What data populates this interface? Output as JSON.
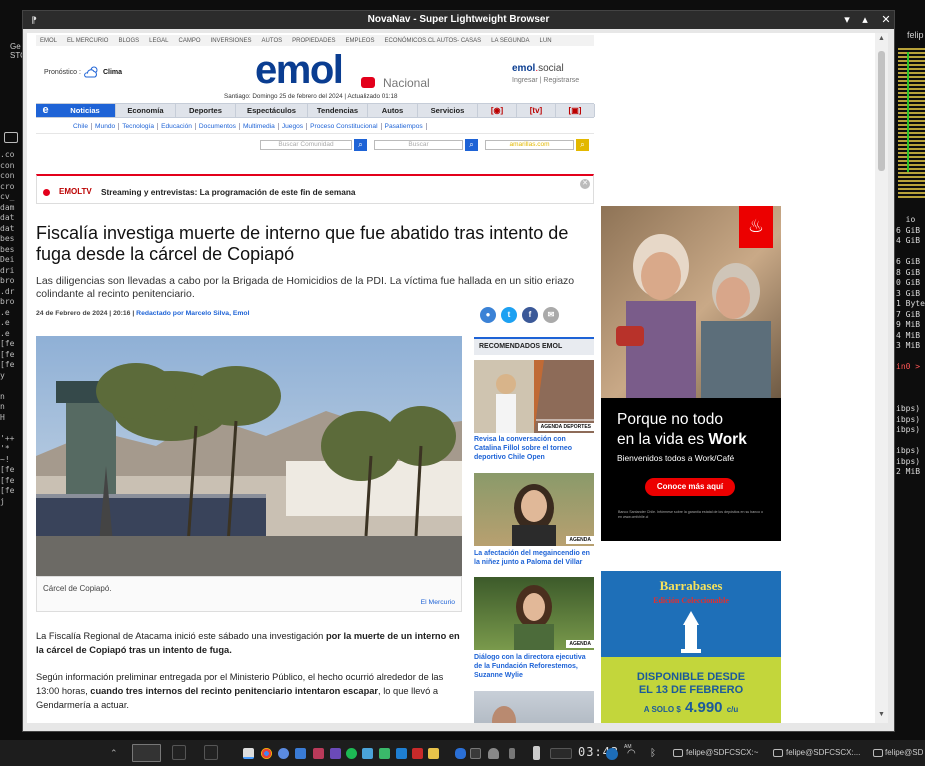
{
  "window": {
    "title": "NovaNav - Super Lightweight Browser"
  },
  "emol": {
    "top_links": [
      "EMOL",
      "EL MERCURIO",
      "BLOGS",
      "LEGAL",
      "CAMPO",
      "INVERSIONES",
      "AUTOS",
      "PROPIEDADES",
      "EMPLEOS",
      "ECONÓMICOS.CL AUTOS- CASAS",
      "LA SEGUNDA",
      "LUN"
    ],
    "pronostico": "Pronóstico :",
    "clima": "Clima",
    "logo": "emol",
    "edition": "Nacional",
    "date": "Santiago: Domingo 25 de febrero del 2024 | Actualizado 01:18",
    "social_brand": "emol",
    "social_dot": ".",
    "social_suffix": "social",
    "social_links": "Ingresar | Registrarse",
    "nav": [
      "Noticias",
      "Economía",
      "Deportes",
      "Espectáculos",
      "Tendencias",
      "Autos",
      "Servicios"
    ],
    "nav_icons": [
      "[◉]",
      "[tv]",
      "[▣]"
    ],
    "home_icon": "e",
    "subnav": [
      "Chile",
      "Mundo",
      "Tecnología",
      "Educación",
      "Documentos",
      "Multimedia",
      "Juegos",
      "Proceso Constitucional",
      "Pasatiempos"
    ],
    "search": {
      "comunidad": "Buscar Comunidad",
      "buscar": "Buscar",
      "amarillas": "amarillas.com"
    }
  },
  "ticker": {
    "label": "EMOLTV",
    "text": "Streaming y entrevistas: La programación de este fin de semana"
  },
  "article": {
    "headline": "Fiscalía investiga muerte de interno que fue abatido tras intento de fuga desde la cárcel de Copiapó",
    "lead": "Las diligencias son llevadas a cabo por la Brigada de Homicidios de la PDI. La víctima fue hallada en un sitio eriazo colindante al recinto penitenciario.",
    "date": "24 de Febrero de 2024 | 20:16 |",
    "author": "Redactado por Marcelo Silva, Emol",
    "caption": "Cárcel de Copiapó.",
    "credit": "El Mercurio",
    "p1_a": "La Fiscalía Regional de Atacama inició este sábado una investigación ",
    "p1_b": "por la muerte de un interno en la cárcel de Copiapó tras un intento de fuga.",
    "p2_a": "Según información preliminar entregada por el Ministerio Público, el hecho ocurrió alrededor de las 13:00 horas, ",
    "p2_b": "cuando tres internos del recinto penitenciario intentaron escapar",
    "p2_c": ", lo que llevó a Gendarmería a actuar."
  },
  "recs": {
    "header": "RECOMENDADOS EMOL",
    "items": [
      {
        "badge": "AGENDA DEPORTES",
        "title": "Revisa la conversación con Catalina Fillol sobre el torneo deportivo Chile Open"
      },
      {
        "badge": "AGENDA",
        "title": "La afectación del megaincendio en la niñez junto a Paloma del Villar"
      },
      {
        "badge": "AGENDA",
        "title": "Diálogo con la directora ejecutiva de la Fundación Reforestemos, Suzanne Wylie"
      },
      {
        "badge": "",
        "title": ""
      }
    ]
  },
  "ad_santander": {
    "line1": "Porque no todo",
    "line2a": "en la vida es ",
    "line2b": "Work",
    "sub": "Bienvenidos todos a Work/Café",
    "cta": "Conoce más aquí",
    "fine": "Banco Santander Chile. Infórmese sobre la garantía estatal de los depósitos en su banco o en www.cmfchile.cl"
  },
  "ad_barrabases": {
    "brand": "Barrabases",
    "sub": "Edición Coleccionable",
    "line1": "DISPONIBLE DESDE",
    "line2": "EL 13 DE FEBRERO",
    "price_prefix": "A SOLO $",
    "price": "4.990",
    "unit": "c/u"
  },
  "taskbar": {
    "clock": "03:43",
    "ampm": "AM",
    "tasks": [
      "felipe@SDFCSCX:~",
      "felipe@SDFCSCX:...",
      "felipe@SD"
    ]
  },
  "desktop": {
    "top_right_task": "felip"
  }
}
